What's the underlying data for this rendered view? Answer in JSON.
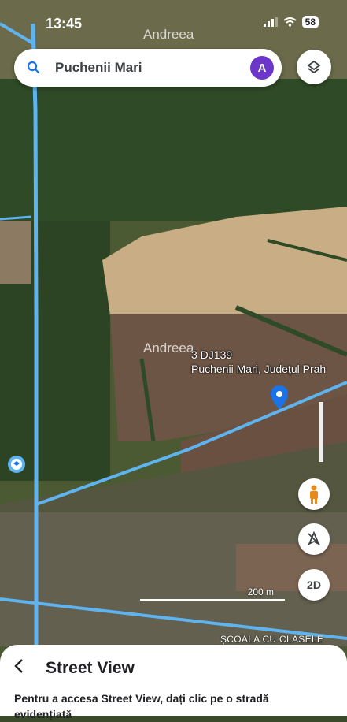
{
  "status_bar": {
    "time": "13:45",
    "battery": "58"
  },
  "watermark": {
    "text": "Andreea"
  },
  "search": {
    "query": "Puchenii Mari",
    "avatar_initial": "A"
  },
  "map": {
    "place_label_line1": "3 DJ139",
    "place_label_line2": "Puchenii Mari, Județul Prah",
    "scale_label": "200 m",
    "poi_label": "ȘCOALA CU CLASELE",
    "view_mode_button": "2D"
  },
  "colors": {
    "route_blue": "#5fb4f0",
    "pin_blue": "#1a73e8",
    "pegman_orange": "#e8891c",
    "avatar_purple": "#6b36c9"
  },
  "icons": [
    "search-icon",
    "layers-icon",
    "pegman-icon",
    "compass-icon",
    "map-pin-icon",
    "back-chevron-icon"
  ],
  "sheet": {
    "title": "Street View",
    "description": "Pentru a accesa Street View, dați clic pe o stradă evidențiată"
  }
}
